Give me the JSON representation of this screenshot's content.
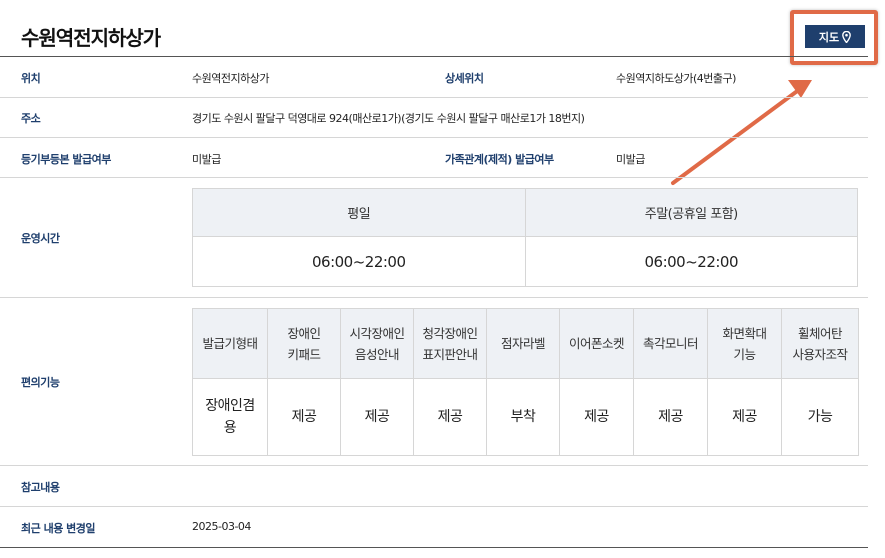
{
  "title": "수원역전지하상가",
  "map_button": {
    "label": "지도",
    "icon": "location-pin-icon"
  },
  "annotation": {
    "highlight_color": "#e06a47"
  },
  "fields": {
    "location": {
      "label": "위치",
      "value": "수원역전지하상가"
    },
    "detail_location": {
      "label": "상세위치",
      "value": "수원역지하도상가(4번출구)"
    },
    "address": {
      "label": "주소",
      "value": "경기도 수원시 팔달구 덕영대로 924(매산로1가)(경기도 수원시 팔달구 매산로1가 18번지)"
    },
    "registry": {
      "label": "등기부등본 발급여부",
      "value": "미발급"
    },
    "family_registry": {
      "label": "가족관계(제적) 발급여부",
      "value": "미발급"
    },
    "hours": {
      "label": "운영시간",
      "headers": [
        "평일",
        "주말(공휴일 포함)"
      ],
      "values": [
        "06:00~22:00",
        "06:00~22:00"
      ]
    },
    "facilities": {
      "label": "편의기능",
      "headers": [
        [
          "발급기형태"
        ],
        [
          "장애인",
          "키패드"
        ],
        [
          "시각장애인",
          "음성안내"
        ],
        [
          "청각장애인",
          "표지판안내"
        ],
        [
          "점자라벨"
        ],
        [
          "이어폰소켓"
        ],
        [
          "촉각모니터"
        ],
        [
          "화면확대",
          "기능"
        ],
        [
          "휠체어탄",
          "사용자조작"
        ]
      ],
      "values": [
        [
          "장애인겸",
          "용"
        ],
        [
          "제공"
        ],
        [
          "제공"
        ],
        [
          "제공"
        ],
        [
          "부착"
        ],
        [
          "제공"
        ],
        [
          "제공"
        ],
        [
          "제공"
        ],
        [
          "가능"
        ]
      ]
    },
    "notes": {
      "label": "참고내용",
      "value": ""
    },
    "last_modified": {
      "label": "최근 내용 변경일",
      "value": "2025-03-04"
    }
  }
}
